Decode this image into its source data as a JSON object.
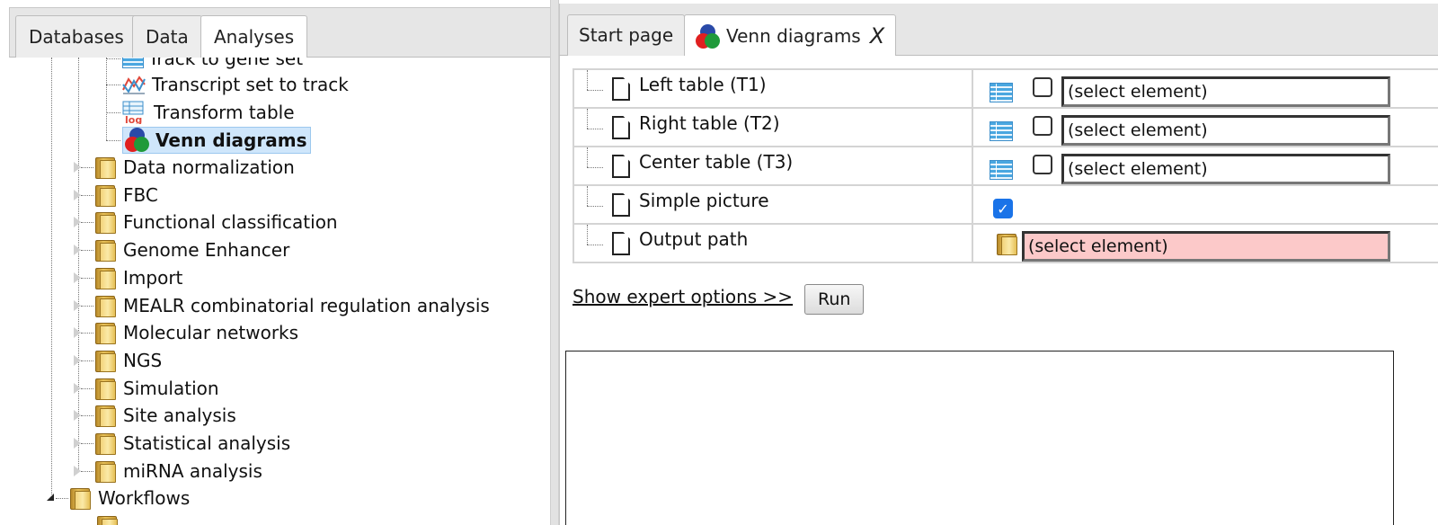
{
  "left_tabs": [
    {
      "label": "Databases",
      "active": false
    },
    {
      "label": "Data",
      "active": false
    },
    {
      "label": "Analyses",
      "active": true
    }
  ],
  "tree": {
    "partial_item": "Track to gene set",
    "analysis_items": [
      {
        "label": "Transcript set to track",
        "icon": "track-transform-icon"
      },
      {
        "label": "Transform table",
        "icon": "log-table-icon"
      },
      {
        "label": "Venn diagrams",
        "icon": "venn-icon",
        "selected": true
      }
    ],
    "folders": [
      "Data normalization",
      "FBC",
      "Functional classification",
      "Genome Enhancer",
      "Import",
      "MEALR combinatorial regulation analysis",
      "Molecular networks",
      "NGS",
      "Simulation",
      "Site analysis",
      "Statistical analysis",
      "miRNA analysis"
    ],
    "root_folder": "Workflows"
  },
  "right_tabs": {
    "start_page": "Start page",
    "venn": "Venn diagrams",
    "close": "X"
  },
  "properties": [
    {
      "name": "Left table (T1)",
      "value": "(select element)"
    },
    {
      "name": "Right table (T2)",
      "value": "(select element)"
    },
    {
      "name": "Center table (T3)",
      "value": "(select element)"
    },
    {
      "name": "Simple picture",
      "checked": true
    },
    {
      "name": "Output path",
      "value": "(select element)"
    }
  ],
  "actions": {
    "expert_link": "Show expert options >>",
    "run": "Run"
  },
  "colors": {
    "selected_bg": "#cfe6fb",
    "required_field": "#fcc9c9",
    "checkbox_checked": "#1a73e8"
  }
}
